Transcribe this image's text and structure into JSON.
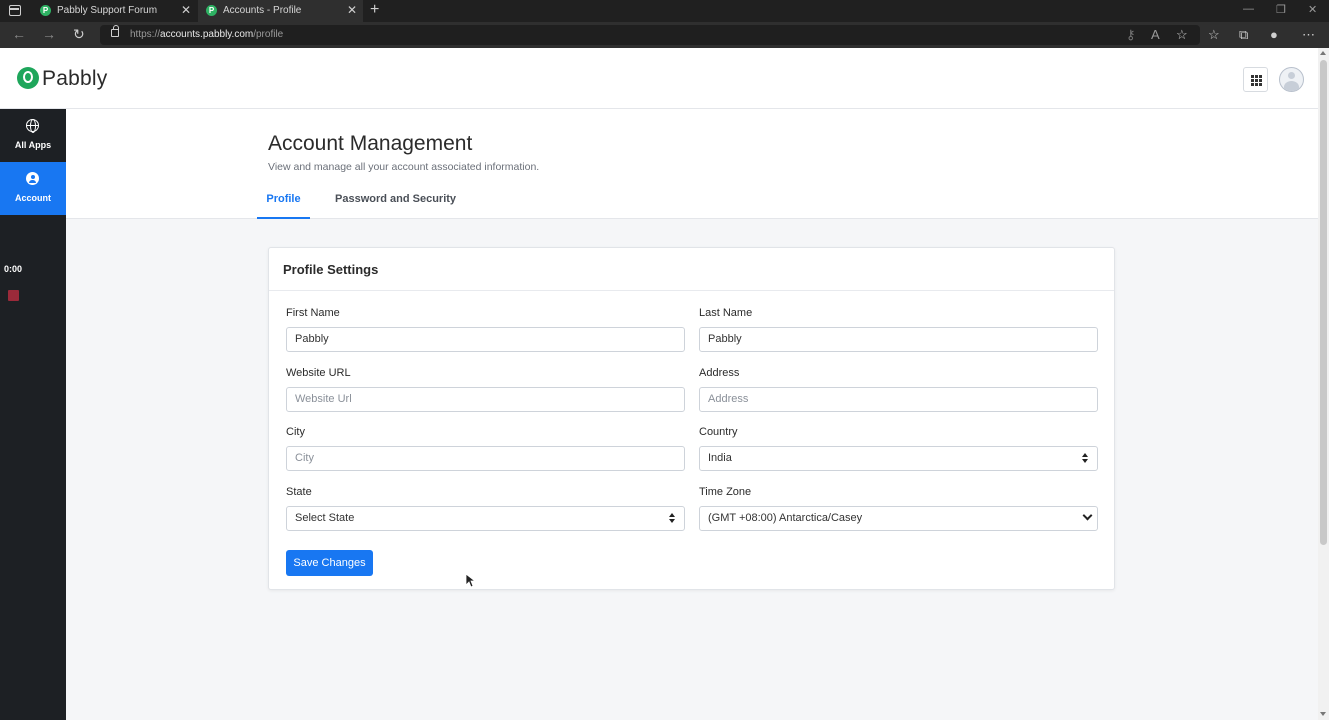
{
  "browser": {
    "tabs": [
      {
        "label": "Pabbly Support Forum",
        "favicon": "P"
      },
      {
        "label": "Accounts - Profile",
        "favicon": "P"
      }
    ],
    "url_prefix": "https://",
    "url_host": "accounts.pabbly.com",
    "url_path": "/profile",
    "window_controls": [
      "—",
      "❐",
      "✕"
    ]
  },
  "header": {
    "logo_text": "Pabbly",
    "logo_color": "#1ea65b"
  },
  "sidebar": {
    "items": [
      {
        "label": "All Apps",
        "icon": "globe-icon"
      },
      {
        "label": "Account",
        "icon": "user-circle-icon"
      }
    ],
    "timer": "0:00",
    "accent": "#1877f2"
  },
  "page": {
    "title": "Account Management",
    "subtitle": "View and manage all your account associated information.",
    "tabs": [
      "Profile",
      "Password and Security"
    ]
  },
  "form": {
    "title": "Profile Settings",
    "first_name": {
      "label": "First Name",
      "value": "Pabbly"
    },
    "last_name": {
      "label": "Last Name",
      "value": "Pabbly"
    },
    "website": {
      "label": "Website URL",
      "placeholder": "Website Url"
    },
    "address": {
      "label": "Address",
      "placeholder": "Address"
    },
    "city": {
      "label": "City",
      "placeholder": "City"
    },
    "country": {
      "label": "Country",
      "value": "India"
    },
    "state": {
      "label": "State",
      "value": "Select State"
    },
    "timezone": {
      "label": "Time Zone",
      "value": "(GMT +08:00) Antarctica/Casey"
    },
    "save_label": "Save Changes"
  }
}
